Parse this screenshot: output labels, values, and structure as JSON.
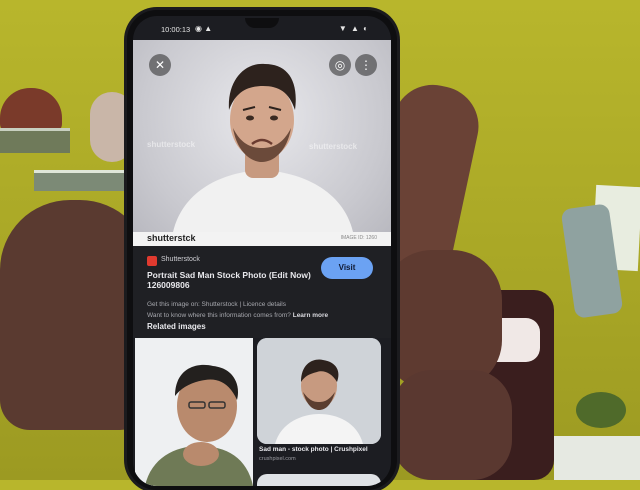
{
  "status_bar": {
    "time": "10:00:13",
    "left_icons": "◉ ▲",
    "right_icons": "▼ ▲ ◐"
  },
  "hero": {
    "close_icon": "close-icon",
    "lens_icon": "lens-icon",
    "more_icon": "more-vert-icon",
    "watermark": "shutterstock"
  },
  "source_strip": {
    "logo": "shutterstck",
    "right": "IMAGE ID: 1260"
  },
  "result": {
    "source": "Shutterstock",
    "title": "Portrait Sad Man Stock Photo (Edit Now) 126009806",
    "visit_label": "Visit",
    "note_line1": "Get this image on: Shutterstock | Licence details",
    "note_line2": "Want to know where this information comes from?",
    "learn_more": "Learn more"
  },
  "related": {
    "label": "Related images",
    "tiles": [
      {
        "caption": "",
        "sub": ""
      },
      {
        "caption": "Sad man - stock photo | Crushpixel",
        "sub": "crushpixel.com"
      }
    ]
  },
  "colors": {
    "visit_button": "#6ba2f3",
    "screen_bg": "#1c1d22",
    "wall": "#b8b62c"
  }
}
